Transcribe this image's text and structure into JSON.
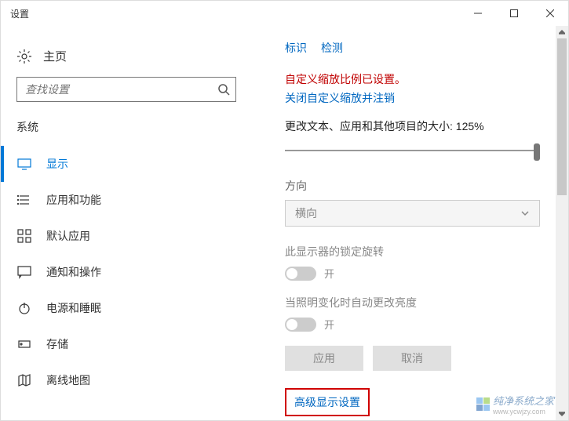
{
  "window": {
    "title": "设置"
  },
  "sidebar": {
    "home_label": "主页",
    "search_placeholder": "查找设置",
    "category": "系统",
    "items": [
      {
        "label": "显示"
      },
      {
        "label": "应用和功能"
      },
      {
        "label": "默认应用"
      },
      {
        "label": "通知和操作"
      },
      {
        "label": "电源和睡眠"
      },
      {
        "label": "存储"
      },
      {
        "label": "离线地图"
      }
    ]
  },
  "main": {
    "link_identify": "标识",
    "link_detect": "检测",
    "warning_text": "自定义缩放比例已设置。",
    "close_scaling_link": "关闭自定义缩放并注销",
    "scale_label": "更改文本、应用和其他项目的大小: 125%",
    "orientation_label": "方向",
    "orientation_value": "横向",
    "lock_rotation_label": "此显示器的锁定旋转",
    "lock_rotation_state": "开",
    "brightness_label": "当照明变化时自动更改亮度",
    "brightness_state": "开",
    "apply_btn": "应用",
    "cancel_btn": "取消",
    "advanced_link": "高级显示设置"
  },
  "watermark": {
    "text": "纯净系统之家",
    "url": "www.ycwjzy.com"
  }
}
